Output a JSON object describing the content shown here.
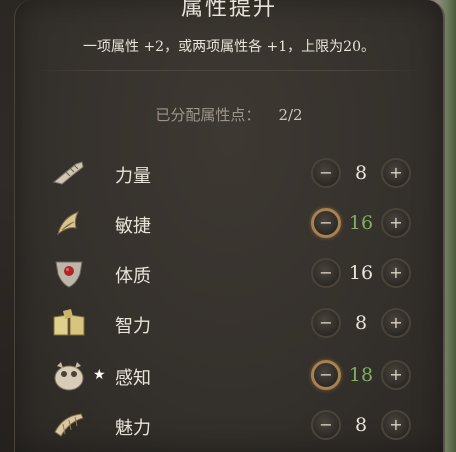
{
  "title": "属性提升",
  "description": "一项属性 +2，或两项属性各 +1，上限为20。",
  "points": {
    "label": "已分配属性点：",
    "value": "2/2"
  },
  "buttons": {
    "minus": "−",
    "plus": "+"
  },
  "colors": {
    "boosted": "#7fb061",
    "active_ring": "#a8824e"
  },
  "abilities": [
    {
      "name": "力量",
      "value": "8",
      "icon": "gauntlet-icon",
      "boosted": false,
      "starred": false
    },
    {
      "name": "敏捷",
      "value": "16",
      "icon": "horn-icon",
      "boosted": true,
      "starred": false
    },
    {
      "name": "体质",
      "value": "16",
      "icon": "heart-shield-icon",
      "boosted": false,
      "starred": false
    },
    {
      "name": "智力",
      "value": "8",
      "icon": "open-book-icon",
      "boosted": false,
      "starred": false
    },
    {
      "name": "感知",
      "value": "18",
      "icon": "owlbear-icon",
      "boosted": true,
      "starred": true,
      "star": "★"
    },
    {
      "name": "魅力",
      "value": "8",
      "icon": "harp-icon",
      "boosted": false,
      "starred": false
    }
  ]
}
